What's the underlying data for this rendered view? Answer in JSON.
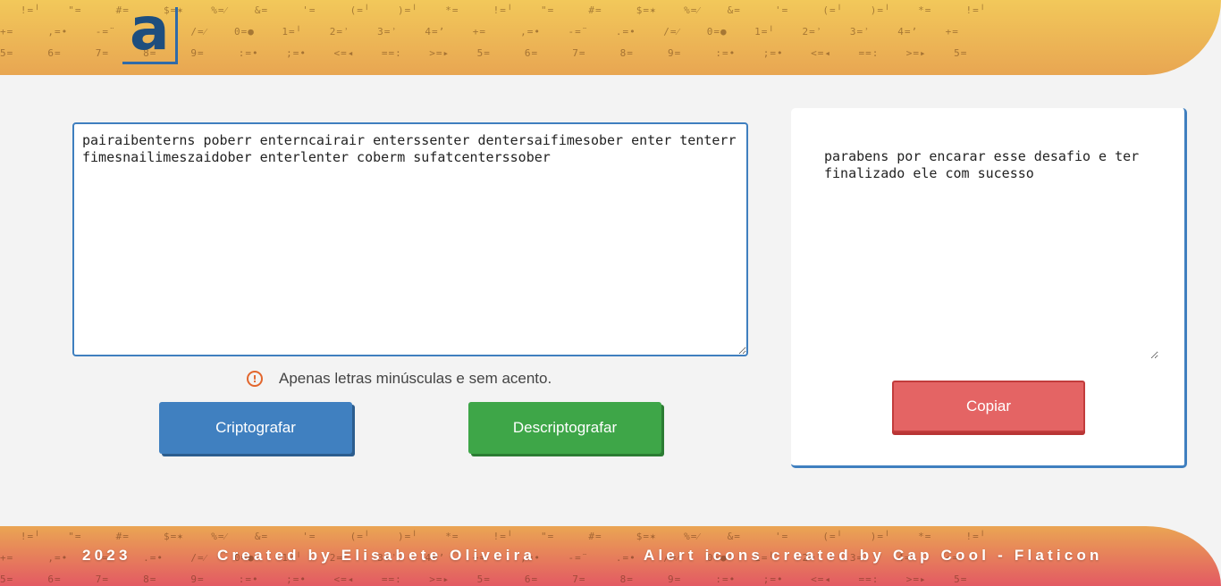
{
  "header": {
    "logo_letter": "a"
  },
  "main": {
    "input_text": "pairaibenterns poberr enterncairair enterssenter dentersaifimesober enter tenterr fimesnailimeszaidober enterlenter coberm sufatcenterssober",
    "hint_text": "Apenas letras minúsculas e sem acento.",
    "encrypt_label": "Criptografar",
    "decrypt_label": "Descriptografar"
  },
  "output": {
    "text": "parabens por encarar esse desafio e ter finalizado ele com sucesso",
    "copy_label": "Copiar"
  },
  "footer": {
    "year": "2023",
    "credit": "Created by Elisabete Oliveira",
    "icons_credit": "Alert icons created by Cap Cool - Flaticon"
  },
  "colors": {
    "encrypt": "#4080c0",
    "decrypt": "#3ea648",
    "copy": "#e46464",
    "accent_border": "#3f7fbf",
    "alert": "#e2662d"
  }
}
